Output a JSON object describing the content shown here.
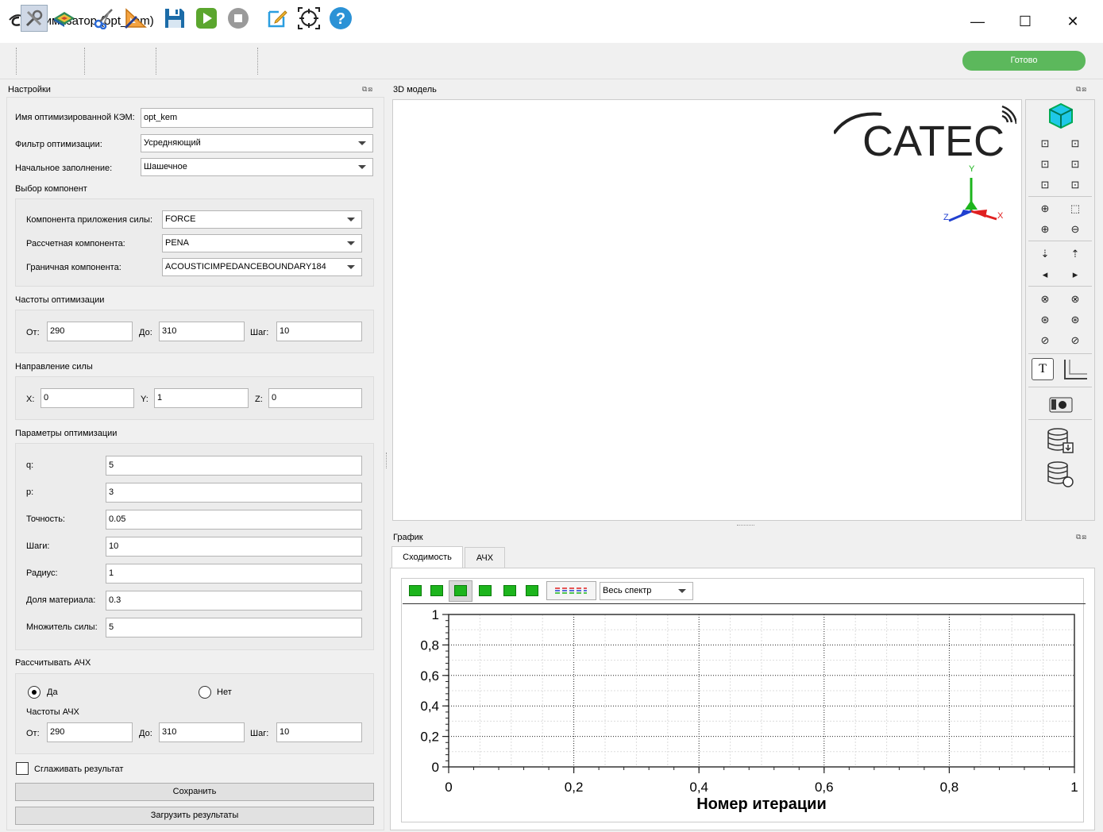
{
  "window": {
    "title": "Оптимизатор (opt_kem)",
    "minimize": "—",
    "maximize": "☐",
    "close": "✕"
  },
  "toolbar": {
    "icons": [
      "settings-icon",
      "model-icon",
      "cut-icon",
      "geometry-icon",
      "save-icon",
      "run-icon",
      "stop-icon",
      "edit-icon",
      "target-icon",
      "help-icon"
    ],
    "status": "Готово",
    "status_color": "#5cb85c"
  },
  "settings": {
    "dock_title": "Настройки",
    "kem_name_label": "Имя оптимизированной КЭМ:",
    "kem_name_value": "opt_kem",
    "filter_label": "Фильтр оптимизации:",
    "filter_value": "Усредняющий",
    "fill_label": "Начальное заполнение:",
    "fill_value": "Шашечное",
    "components_section": "Выбор компонент",
    "force_comp_label": "Компонента приложения силы:",
    "force_comp_value": "FORCE",
    "calc_comp_label": "Рассчетная компонента:",
    "calc_comp_value": "PENA",
    "boundary_comp_label": "Граничная компонента:",
    "boundary_comp_value": "ACOUSTICIMPEDANCEBOUNDARY184",
    "freq_section": "Частоты оптимизации",
    "from_label": "От:",
    "from_value": "290",
    "to_label": "До:",
    "to_value": "310",
    "step_label": "Шаг:",
    "step_value": "10",
    "direction_section": "Направление силы",
    "x_label": "X:",
    "x_value": "0",
    "y_label": "Y:",
    "y_value": "1",
    "z_label": "Z:",
    "z_value": "0",
    "params_section": "Параметры оптимизации",
    "q_label": "q:",
    "q_value": "5",
    "p_label": "p:",
    "p_value": "3",
    "accuracy_label": "Точность:",
    "accuracy_value": "0.05",
    "steps_label": "Шаги:",
    "steps_value": "10",
    "radius_label": "Радиус:",
    "radius_value": "1",
    "material_label": "Доля материала:",
    "material_value": "0.3",
    "force_mult_label": "Множитель силы:",
    "force_mult_value": "5",
    "afc_section": "Рассчитывать АЧХ",
    "yes_label": "Да",
    "no_label": "Нет",
    "afc_freq_label": "Частоты АЧХ",
    "afc_from_value": "290",
    "afc_to_value": "310",
    "afc_step_value": "10",
    "smooth_label": "Сглаживать результат",
    "save_button": "Сохранить",
    "load_button": "Загрузить результаты"
  },
  "model": {
    "dock_title": "3D модель",
    "logo_text": "CATEC",
    "axis_x": "X",
    "axis_y": "Y",
    "axis_z": "Z"
  },
  "graph": {
    "dock_title": "График",
    "tabs": [
      "Сходимость",
      "АЧХ"
    ],
    "spectrum_select": "Весь спектр"
  },
  "chart_data": {
    "type": "line",
    "title": "",
    "xlabel": "Номер итерации",
    "ylabel": "",
    "xlim": [
      0,
      1
    ],
    "ylim": [
      0,
      1
    ],
    "x_ticks": [
      "0",
      "0,2",
      "0,4",
      "0,6",
      "0,8",
      "1"
    ],
    "y_ticks": [
      "0",
      "0,2",
      "0,4",
      "0,6",
      "0,8",
      "1"
    ],
    "grid": true,
    "series": []
  }
}
